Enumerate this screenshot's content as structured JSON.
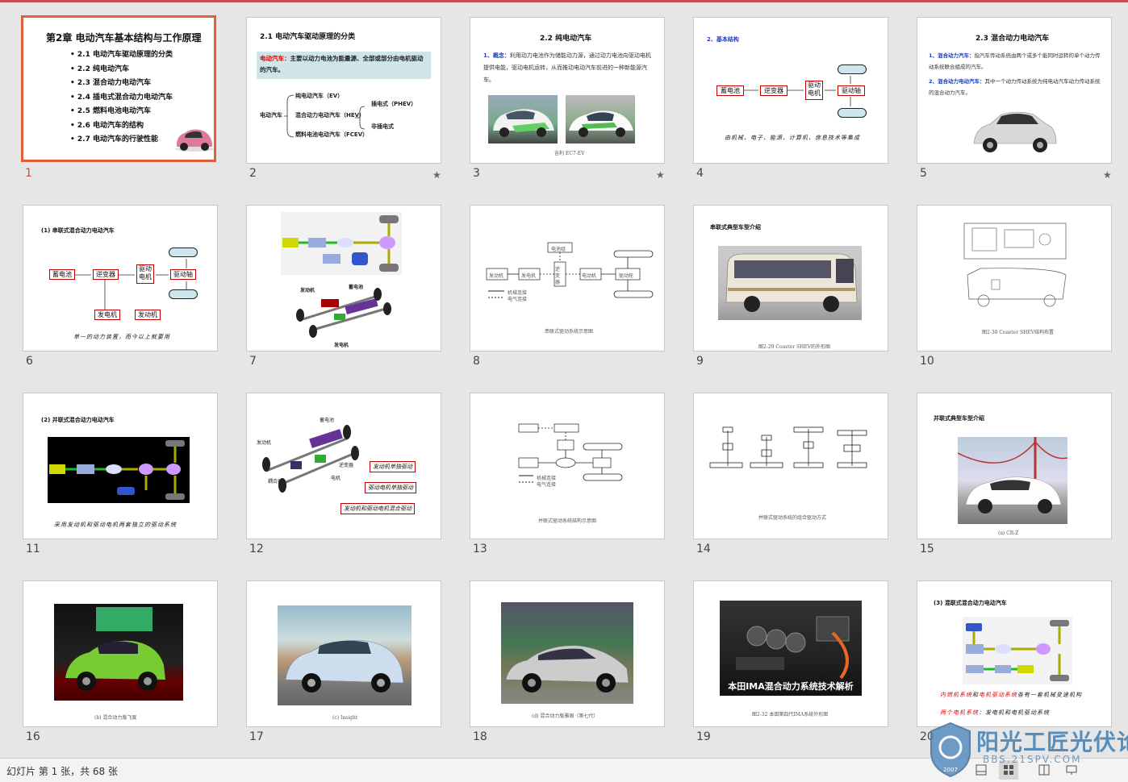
{
  "slides": [
    {
      "num": "1",
      "selected": true,
      "title": "第2章 电动汽车基本结构与工作原理",
      "bullets": [
        "2.1  电动汽车驱动原理的分类",
        "2.2  纯电动汽车",
        "2.3  混合动力电动汽车",
        "2.4  插电式混合动力电动汽车",
        "2.5  燃料电池电动汽车",
        "2.6  电动汽车的结构",
        "2.7  电动汽车的行驶性能"
      ]
    },
    {
      "num": "2",
      "star": "★",
      "title": "2.1  电动汽车驱动原理的分类",
      "highlight_label": "电动汽车：",
      "highlight_text": "主要以动力电池为能量源、全部或部分由电机驱动的汽车。",
      "root": "电动汽车",
      "branches": [
        "纯电动汽车（EV）",
        "混合动力电动汽车（HEV）",
        "燃料电池电动汽车（FCEV）"
      ],
      "sub": [
        "插电式（PHEV）",
        "非插电式"
      ]
    },
    {
      "num": "3",
      "star": "★",
      "title": "2.2  纯电动汽车",
      "label": "1、概念：",
      "text": "利用动力电池作为储能动力源，通过动力电池向驱动电机提供电能，驱动电机运转，从而推动电动汽车前进的一种新能源汽车。",
      "caption": "吉利 EC7-EV"
    },
    {
      "num": "4",
      "title": "2、基本结构",
      "blocks": [
        "蓄电池",
        "逆变器",
        "驱动电机",
        "驱动轴"
      ],
      "note": "由机械、电子、能源、计算机、信息技术等集成"
    },
    {
      "num": "5",
      "star": "★",
      "title": "2.3  混合动力电动汽车",
      "p1_label": "1、混合动力汽车：",
      "p1_text": "指汽车传动系统由两个或多个能同时运转的单个动力传动系统联合组成的汽车。",
      "p2_label": "2、混合动力电动汽车：",
      "p2_text": "其中一个动力传动系统为纯电动汽车动力传动系统的混合动力汽车。"
    },
    {
      "num": "6",
      "title": "(1)  串联式混合动力电动汽车",
      "blocks": [
        "蓄电池",
        "逆变器",
        "驱动电机",
        "驱动轴",
        "发电机",
        "发动机"
      ],
      "note": "单一的动力装置，而今以上就要用"
    },
    {
      "num": "7",
      "labels": [
        "蓄电池",
        "发动机",
        "发电机"
      ]
    },
    {
      "num": "8",
      "blocks": [
        "电池组",
        "发动机",
        "发电机",
        "逆变器",
        "电动机",
        "驱动轮"
      ],
      "legend": [
        "机械连接",
        "电气连接"
      ],
      "caption": "串联式驱动系统示意图"
    },
    {
      "num": "9",
      "title": "串联式典型车型介绍",
      "caption": "图2-29 Coaster SHEV的外形图"
    },
    {
      "num": "10",
      "caption": "图2-30 Coaster SHEV结构布置"
    },
    {
      "num": "11",
      "title": "(2)  并联式混合动力电动汽车",
      "note": "采用发动机和驱动电机两套独立的驱动系统"
    },
    {
      "num": "12",
      "labels": [
        "蓄电池",
        "发动机",
        "电机",
        "逆变器",
        "耦合器"
      ],
      "boxes": [
        "发动机单独驱动",
        "驱动电机单独驱动",
        "发动机和驱动电机混合驱动"
      ]
    },
    {
      "num": "13",
      "caption": "并联式驱动系统结构示意图",
      "legend": [
        "机械连接",
        "电气连接"
      ]
    },
    {
      "num": "14",
      "caption": "并联式驱动系统的组合驱动方式"
    },
    {
      "num": "15",
      "title": "并联式典型车型介绍",
      "caption": "(a) CR-Z"
    },
    {
      "num": "16",
      "caption": "(b) 混合动力版飞度"
    },
    {
      "num": "17",
      "caption": "(c) Insight"
    },
    {
      "num": "18",
      "caption": "(d) 混合动力版雅阁（第七代）"
    },
    {
      "num": "19",
      "banner": "本田IMA混合动力系统技术解析",
      "caption": "图2-32 本田第四代IMA系统外形图"
    },
    {
      "num": "20",
      "title": "(3)  混联式混合动力电动汽车",
      "note1_red": "内燃机系统",
      "note1_mid": "和",
      "note1_red2": "电机驱动系统",
      "note1_end": "各有一套机械变速机构",
      "note2_red": "两个电机系统：",
      "note2_end": "发电机和电机驱动系统"
    }
  ],
  "status": {
    "text": "幻灯片 第 1 张，共 68 张"
  },
  "view_buttons": [
    "normal-view-icon",
    "slide-sorter-icon",
    "reading-view-icon",
    "slideshow-icon"
  ],
  "watermark": {
    "title": "阳光工匠光伏论坛",
    "sub": "BBS.21SPV.COM",
    "year": "2007"
  }
}
